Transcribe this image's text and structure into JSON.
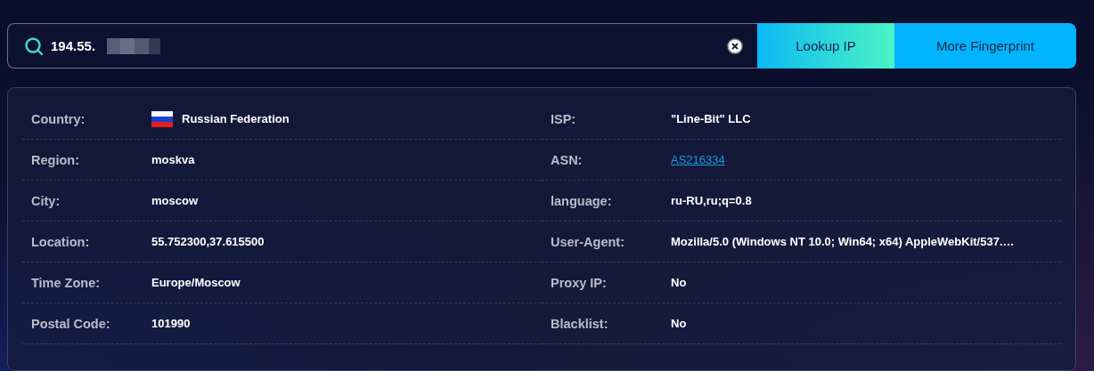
{
  "search": {
    "value": "194.55.",
    "redacted": true,
    "buttons": [
      {
        "label": "Lookup IP",
        "kind": "gradient"
      },
      {
        "label": "More Fingerprint",
        "kind": "solid"
      }
    ]
  },
  "details": {
    "columns": [
      {
        "rows": [
          {
            "label": "Country:",
            "value": "Russian Federation",
            "kind": "flag"
          },
          {
            "label": "Region:",
            "value": "moskva",
            "kind": "text"
          },
          {
            "label": "City:",
            "value": "moscow",
            "kind": "text"
          },
          {
            "label": "Location:",
            "value": "55.752300,37.615500",
            "kind": "text"
          },
          {
            "label": "Time Zone:",
            "value": "Europe/Moscow",
            "kind": "text"
          },
          {
            "label": "Postal Code:",
            "value": "101990",
            "kind": "text"
          }
        ]
      },
      {
        "rows": [
          {
            "label": "ISP:",
            "value": "\"Line-Bit\" LLC",
            "kind": "text"
          },
          {
            "label": "ASN:",
            "value": "AS216334",
            "kind": "link"
          },
          {
            "label": "language:",
            "value": "ru-RU,ru;q=0.8",
            "kind": "text"
          },
          {
            "label": "User-Agent:",
            "value": "Mozilla/5.0 (Windows NT 10.0; Win64; x64) AppleWebKit/537.…",
            "kind": "text"
          },
          {
            "label": "Proxy IP:",
            "value": "No",
            "kind": "text"
          },
          {
            "label": "Blacklist:",
            "value": "No",
            "kind": "text"
          }
        ]
      }
    ]
  }
}
